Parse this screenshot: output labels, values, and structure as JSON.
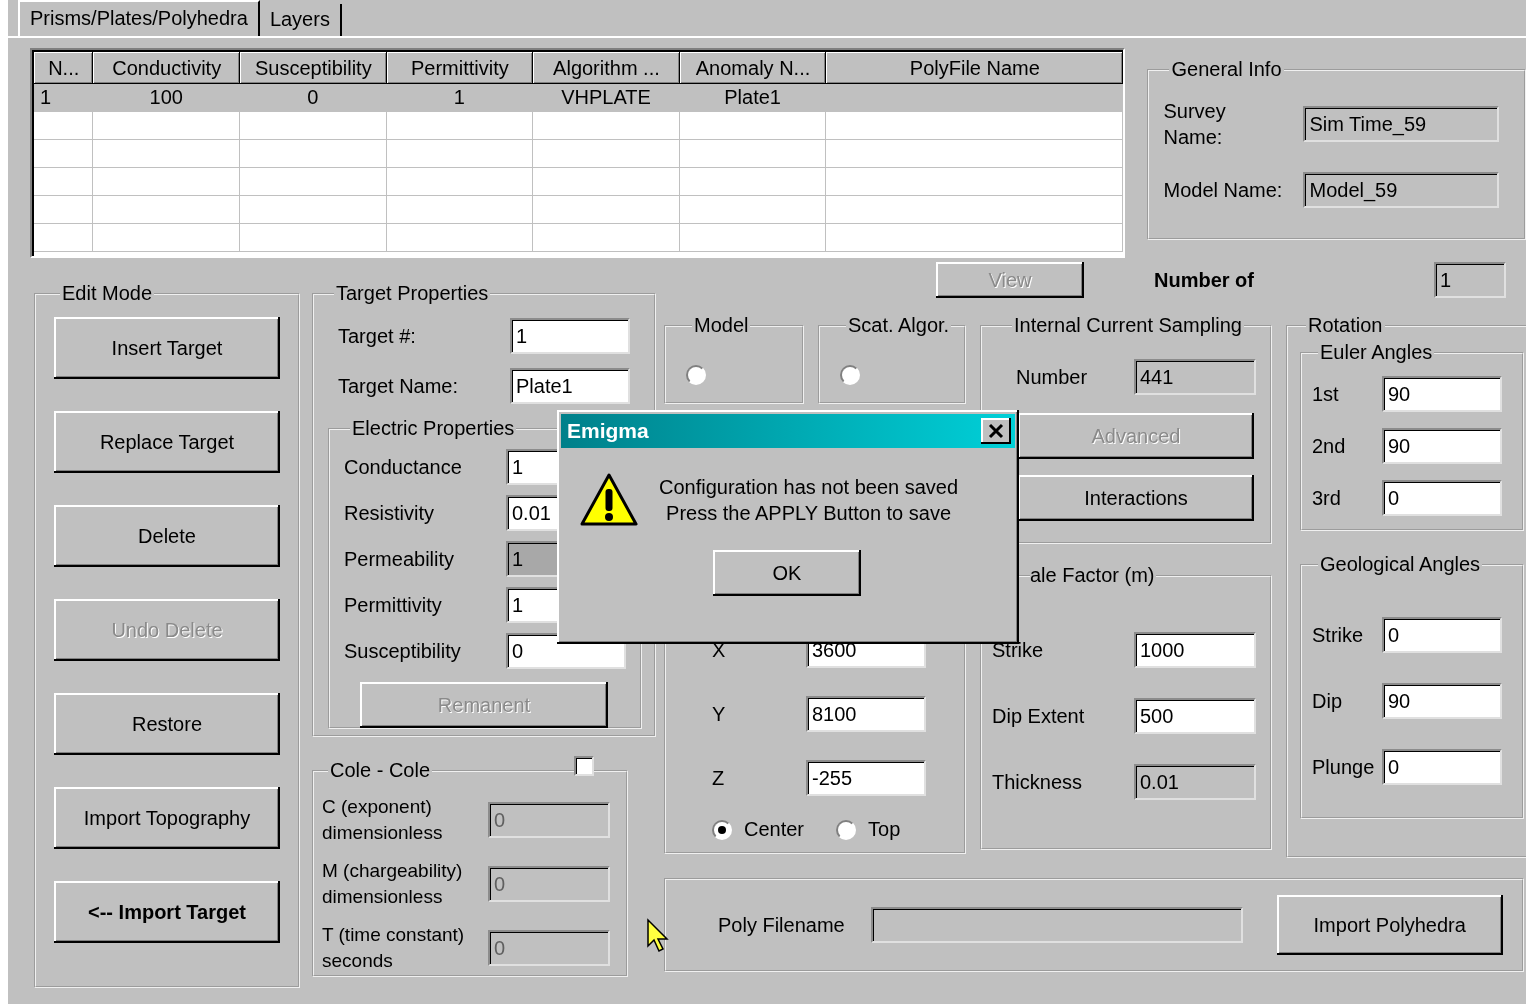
{
  "tabs": [
    {
      "label": "Prisms/Plates/Polyhedra",
      "selected": true
    },
    {
      "label": "Layers",
      "selected": false
    }
  ],
  "table": {
    "columns": [
      "N...",
      "Conductivity",
      "Susceptibility",
      "Permittivity",
      "Algorithm ...",
      "Anomaly N...",
      "PolyFile Name"
    ],
    "rows": [
      {
        "selected": true,
        "cells": [
          "1",
          "100",
          "0",
          "1",
          "VHPLATE",
          "Plate1"
        ]
      }
    ]
  },
  "general_info": {
    "title": "General Info",
    "fields": [
      {
        "label": "Survey\nName:",
        "value": "Sim Time_59"
      },
      {
        "label": "Model Name:",
        "value": "Model_59"
      }
    ]
  },
  "view_button": {
    "label": "View",
    "disabled": true
  },
  "number_of": {
    "label": "Number of",
    "value": "1"
  },
  "edit_mode": {
    "title": "Edit Mode",
    "buttons": [
      {
        "label": "Insert Target",
        "disabled": false,
        "bold": false
      },
      {
        "label": "Replace Target",
        "disabled": false,
        "bold": false
      },
      {
        "label": "Delete",
        "disabled": false,
        "bold": false
      },
      {
        "label": "Undo Delete",
        "disabled": true,
        "bold": false
      },
      {
        "label": "Restore",
        "disabled": false,
        "bold": false
      },
      {
        "label": "Import Topography",
        "disabled": false,
        "bold": false
      },
      {
        "label": "<-- Import Target",
        "disabled": false,
        "bold": true
      }
    ]
  },
  "target_properties": {
    "title": "Target Properties",
    "fields": [
      {
        "label": "Target #:",
        "value": "1"
      },
      {
        "label": "Target Name:",
        "value": "Plate1"
      }
    ],
    "electric": {
      "title": "Electric Properties",
      "fields": [
        {
          "label": "Conductance",
          "value": "1",
          "disabled": false
        },
        {
          "label": "Resistivity",
          "value": "0.01",
          "disabled": false
        },
        {
          "label": "Permeability",
          "value": "1",
          "disabled": true
        },
        {
          "label": "Permittivity",
          "value": "1",
          "disabled": false
        },
        {
          "label": "Susceptibility",
          "value": "0",
          "disabled": false
        }
      ]
    },
    "remanent_button": {
      "label": "Remanent",
      "disabled": true
    }
  },
  "cole_cole": {
    "title": "Cole - Cole",
    "checked": false,
    "fields": [
      {
        "label": "C (exponent)\ndimensionless",
        "value": "0",
        "disabled": true
      },
      {
        "label": "M (chargeability)\ndimensionless",
        "value": "0",
        "disabled": true
      },
      {
        "label": "T (time constant)\nseconds",
        "value": "0",
        "disabled": true
      }
    ]
  },
  "model": {
    "title": "Model",
    "options": [
      {
        "selected": false
      }
    ]
  },
  "scat_algor": {
    "title": "Scat. Algor.",
    "options": [
      {
        "selected": false
      }
    ]
  },
  "position": {
    "fields": [
      {
        "label": "X",
        "value": "3600"
      },
      {
        "label": "Y",
        "value": "8100"
      },
      {
        "label": "Z",
        "value": "-255"
      }
    ],
    "anchors": [
      {
        "label": "Center",
        "selected": true
      },
      {
        "label": "Top",
        "selected": false
      }
    ]
  },
  "internal_current_sampling": {
    "title": "Internal Current Sampling",
    "number_label": "Number",
    "number_value": "441",
    "buttons": [
      {
        "label": "Advanced",
        "disabled": true
      },
      {
        "label": "Interactions",
        "disabled": false
      }
    ]
  },
  "scale_factor": {
    "title": "ale Factor (m)",
    "fields": [
      {
        "label": "Strike",
        "value": "1000",
        "disabled": false
      },
      {
        "label": "Dip Extent",
        "value": "500",
        "disabled": false
      },
      {
        "label": "Thickness",
        "value": "0.01",
        "disabled": true
      }
    ]
  },
  "rotation": {
    "title": "Rotation",
    "euler": {
      "title": "Euler Angles",
      "fields": [
        {
          "label": "1st",
          "value": "90"
        },
        {
          "label": "2nd",
          "value": "90"
        },
        {
          "label": "3rd",
          "value": "0"
        }
      ]
    },
    "geological": {
      "title": "Geological Angles",
      "fields": [
        {
          "label": "Strike",
          "value": "0"
        },
        {
          "label": "Dip",
          "value": "90"
        },
        {
          "label": "Plunge",
          "value": "0"
        }
      ]
    }
  },
  "poly": {
    "label": "Poly Filename",
    "button": "Import Polyhedra"
  },
  "dialog": {
    "title": "Emigma",
    "message": "Configuration has not been saved\nPress the APPLY Button to save",
    "ok": "OK"
  }
}
